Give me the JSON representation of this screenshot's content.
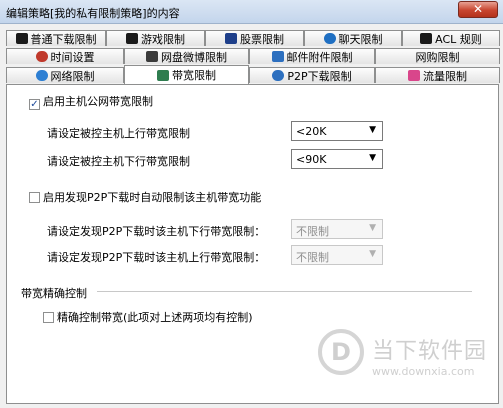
{
  "window": {
    "title": "编辑策略[我的私有限制策略]的内容",
    "close_glyph": "✕"
  },
  "tabs": {
    "row1": [
      {
        "label": "普通下载限制",
        "icon": "download-icon",
        "color": "#1a1a1a"
      },
      {
        "label": "游戏限制",
        "icon": "game-icon",
        "color": "#1a1a1a"
      },
      {
        "label": "股票限制",
        "icon": "stock-icon",
        "color": "#1e3f8a"
      },
      {
        "label": "聊天限制",
        "icon": "chat-icon",
        "color": "#1f6fc2"
      },
      {
        "label": "ACL 规则",
        "icon": "acl-icon",
        "color": "#1a1a1a"
      }
    ],
    "row2": [
      {
        "label": "时间设置",
        "icon": "clock-icon",
        "color": "#c0392b"
      },
      {
        "label": "网盘微博限制",
        "icon": "cloud-icon",
        "color": "#3b3b3b"
      },
      {
        "label": "邮件附件限制",
        "icon": "mail-icon",
        "color": "#2c6fbf"
      },
      {
        "label": "网购限制",
        "icon": "",
        "color": ""
      }
    ],
    "row3": [
      {
        "label": "网络限制",
        "icon": "globe-icon",
        "color": "#2d7fd3"
      },
      {
        "label": "带宽限制",
        "icon": "bandwidth-icon",
        "color": "#2f7d4f"
      },
      {
        "label": "P2P下载限制",
        "icon": "p2p-icon",
        "color": "#2c6fbf"
      },
      {
        "label": "流量限制",
        "icon": "traffic-icon",
        "color": "#d9468b"
      }
    ]
  },
  "bandwidth": {
    "enable_label": "启用主机公网带宽限制",
    "enable_checked": true,
    "upload_label": "请设定被控主机上行带宽限制",
    "upload_value": "<20K",
    "download_label": "请设定被控主机下行带宽限制",
    "download_value": "<90K"
  },
  "p2p": {
    "enable_label": "启用发现P2P下载时自动限制该主机带宽功能",
    "enable_checked": false,
    "down_label": "请设定发现P2P下载时该主机下行带宽限制：",
    "down_value": "不限制",
    "up_label": "请设定发现P2P下载时该主机上行带宽限制：",
    "up_value": "不限制"
  },
  "precise": {
    "group_label": "带宽精确控制",
    "checkbox_label": "精确控制带宽(此项对上述两项均有控制)",
    "checked": false
  },
  "watermark": {
    "glyph": "D",
    "text": "当下软件园",
    "url": "www.downxia.com"
  }
}
